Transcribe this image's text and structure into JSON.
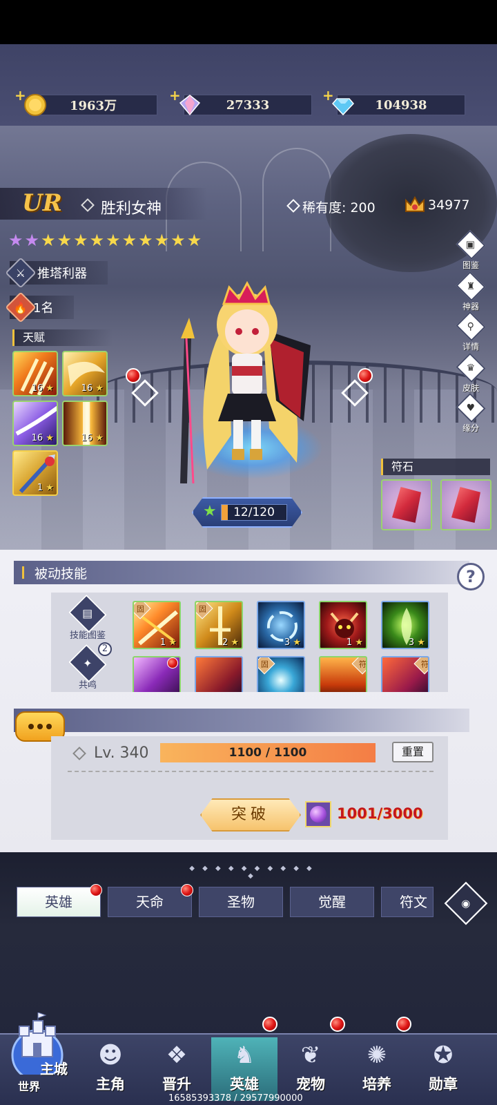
{
  "resources": {
    "gold": "1963万",
    "crystal": "27333",
    "diamond": "104938"
  },
  "hero": {
    "grade": "UR",
    "name": "胜利女神",
    "rarity_label": "稀有度",
    "rarity_separator": ":",
    "rarity_value": "200",
    "power": "34977",
    "purple_stars": 2,
    "gold_stars": 10,
    "role_tag": "推塔利器",
    "rank": "1名"
  },
  "talents": {
    "title": "天赋",
    "items": [
      {
        "level": "16",
        "icon": "flame-claw-icon"
      },
      {
        "level": "16",
        "icon": "golden-wing-icon"
      },
      {
        "level": "16",
        "icon": "violet-slash-icon"
      },
      {
        "level": "16",
        "icon": "light-pillar-icon"
      },
      {
        "level": "1",
        "icon": "spear-icon"
      }
    ]
  },
  "side_menu": [
    {
      "label": "图鉴",
      "icon": "codex-icon"
    },
    {
      "label": "神器",
      "icon": "artifact-icon"
    },
    {
      "label": "详情",
      "icon": "magnifier-icon"
    },
    {
      "label": "皮肤",
      "icon": "skin-icon"
    },
    {
      "label": "缘分",
      "icon": "heart-icon"
    }
  ],
  "level": {
    "text": "12/120",
    "fraction": 0.1
  },
  "runes": {
    "title": "符石"
  },
  "passive": {
    "title": "被动技能",
    "help": "?",
    "codex_label": "技能图鉴",
    "resonance_label": "共鸣",
    "resonance_count": "2",
    "fixed_badge": "固",
    "skills_row1": [
      {
        "level": "1",
        "fixed": true,
        "icon": "fire-burst-icon"
      },
      {
        "level": "2",
        "fixed": true,
        "icon": "golden-sword-icon"
      },
      {
        "level": "3",
        "fixed": false,
        "icon": "ice-vortex-icon"
      },
      {
        "level": "1",
        "fixed": false,
        "icon": "demon-icon"
      },
      {
        "level": "3",
        "fixed": false,
        "icon": "green-spirit-icon"
      }
    ]
  },
  "breakthrough": {
    "level": "Lv. 340",
    "exp": "1100 / 1100",
    "reset": "重置",
    "button": "突破",
    "cost": "1001/3000"
  },
  "tabs": [
    "英雄",
    "天命",
    "圣物",
    "觉醒",
    "符文"
  ],
  "bottom_nav": {
    "castle": "主城",
    "world": "世界",
    "items": [
      "主角",
      "晋升",
      "英雄",
      "宠物",
      "培养",
      "勋章"
    ]
  },
  "footer": "16585393378 / 29577990000",
  "colors": {
    "accent_gold": "#f0c23c",
    "badge_red": "#e01818",
    "panel_header": "#5b6088"
  }
}
